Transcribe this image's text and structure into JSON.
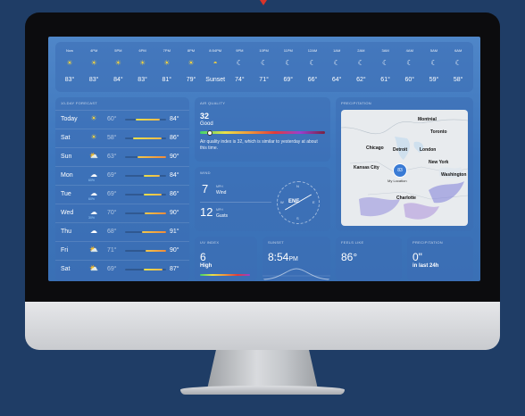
{
  "colors": {
    "background": "#1f3d66",
    "screen": "#3d76bd",
    "sun": "#f6d43c",
    "accent": "#d8342a"
  },
  "hourly": [
    {
      "label": "Now",
      "icon": "sun-icon",
      "temp": "83°"
    },
    {
      "label": "4PM",
      "icon": "sun-icon",
      "temp": "83°"
    },
    {
      "label": "5PM",
      "icon": "sun-icon",
      "temp": "84°"
    },
    {
      "label": "6PM",
      "icon": "sun-icon",
      "temp": "83°"
    },
    {
      "label": "7PM",
      "icon": "sun-icon",
      "temp": "81°"
    },
    {
      "label": "8PM",
      "icon": "sun-icon",
      "temp": "79°"
    },
    {
      "label": "8:54PM",
      "icon": "sunset-icon",
      "temp": "Sunset"
    },
    {
      "label": "9PM",
      "icon": "moon-icon",
      "temp": "74°"
    },
    {
      "label": "10PM",
      "icon": "moon-icon",
      "temp": "71°"
    },
    {
      "label": "11PM",
      "icon": "moon-icon",
      "temp": "69°"
    },
    {
      "label": "12AM",
      "icon": "moon-icon",
      "temp": "66°"
    },
    {
      "label": "1AM",
      "icon": "moon-icon",
      "temp": "64°"
    },
    {
      "label": "2AM",
      "icon": "moon-icon",
      "temp": "62°"
    },
    {
      "label": "3AM",
      "icon": "moon-icon",
      "temp": "61°"
    },
    {
      "label": "4AM",
      "icon": "moon-icon",
      "temp": "60°"
    },
    {
      "label": "5AM",
      "icon": "moon-icon",
      "temp": "59°"
    },
    {
      "label": "6AM",
      "icon": "moon-icon",
      "temp": "58°"
    }
  ],
  "forecast": {
    "title": "10-DAY FORECAST",
    "days": [
      {
        "day": "Today",
        "icon": "sun-icon",
        "pct": "",
        "low": "60°",
        "high": "84°",
        "bar_from": 0.25,
        "bar_to": 0.85
      },
      {
        "day": "Sat",
        "icon": "sun-icon",
        "pct": "",
        "low": "58°",
        "high": "86°",
        "bar_from": 0.2,
        "bar_to": 0.9
      },
      {
        "day": "Sun",
        "icon": "partly-cloudy-icon",
        "pct": "",
        "low": "63°",
        "high": "90°",
        "bar_from": 0.3,
        "bar_to": 1.0
      },
      {
        "day": "Mon",
        "icon": "cloud-rain-icon",
        "pct": "60%",
        "low": "69°",
        "high": "84°",
        "bar_from": 0.45,
        "bar_to": 0.85
      },
      {
        "day": "Tue",
        "icon": "cloud-rain-icon",
        "pct": "60%",
        "low": "69°",
        "high": "86°",
        "bar_from": 0.45,
        "bar_to": 0.9
      },
      {
        "day": "Wed",
        "icon": "cloud-rain-icon",
        "pct": "30%",
        "low": "70°",
        "high": "90°",
        "bar_from": 0.48,
        "bar_to": 1.0
      },
      {
        "day": "Thu",
        "icon": "cloud-rain-icon",
        "pct": "",
        "low": "68°",
        "high": "91°",
        "bar_from": 0.42,
        "bar_to": 1.0
      },
      {
        "day": "Fri",
        "icon": "partly-cloudy-icon",
        "pct": "",
        "low": "71°",
        "high": "90°",
        "bar_from": 0.5,
        "bar_to": 1.0
      },
      {
        "day": "Sat",
        "icon": "partly-cloudy-icon",
        "pct": "",
        "low": "69°",
        "high": "87°",
        "bar_from": 0.45,
        "bar_to": 0.92
      }
    ]
  },
  "air_quality": {
    "title": "AIR QUALITY",
    "value": "32",
    "category": "Good",
    "level": 0.06,
    "description": "Air quality index is 32, which is similar to yesterday at about this time."
  },
  "wind": {
    "title": "WIND",
    "speed": "7",
    "speed_unit": "MPH",
    "speed_label": "Wind",
    "gust": "12",
    "gust_unit": "MPH",
    "gust_label": "Gusts",
    "direction": "ENE",
    "compass": {
      "n": "N",
      "e": "E",
      "s": "S",
      "w": "W"
    }
  },
  "map": {
    "title": "PRECIPITATION",
    "cities": [
      "Montréal",
      "Toronto",
      "Chicago",
      "Detroit",
      "London",
      "Kansas City",
      "New York",
      "Washington",
      "My Location",
      "Charlotte"
    ],
    "location_value": "83"
  },
  "uv": {
    "title": "UV INDEX",
    "value": "6",
    "category": "High",
    "level": 0.55
  },
  "sunset": {
    "title": "SUNSET",
    "time": "8:54",
    "suffix": "PM"
  },
  "feels_like": {
    "title": "FEELS LIKE",
    "value": "86°"
  },
  "precipitation": {
    "title": "PRECIPITATION",
    "value": "0\"",
    "sub": "in last 24h"
  }
}
